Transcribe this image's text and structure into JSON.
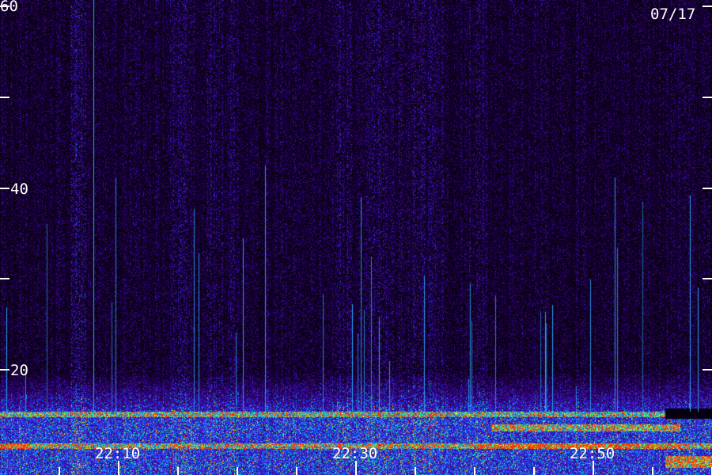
{
  "date_label": "07/17",
  "y_axis": {
    "labels": [
      "60",
      "40",
      "20"
    ],
    "ticks": [
      60,
      50,
      40,
      30,
      20
    ]
  },
  "x_axis": {
    "labels": [
      "22:10",
      "22:30",
      "22:50"
    ],
    "minor_tick_count": 12
  },
  "colors": {
    "background": "#000000",
    "low_intensity": "#3a0a8a",
    "mid_intensity": "#2050ff",
    "high_intensity": "#00e0ff",
    "peak_intensity": "#ffff00",
    "max_intensity": "#ff3000",
    "label": "#ffffff"
  }
}
